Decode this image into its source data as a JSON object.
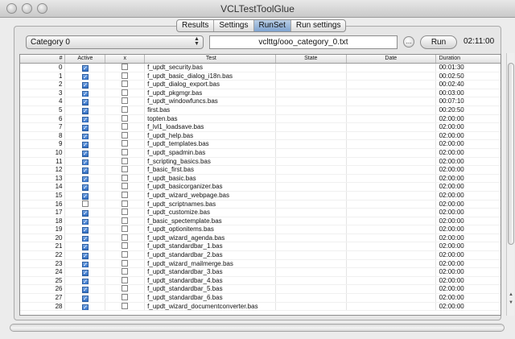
{
  "window": {
    "title": "VCLTestToolGlue"
  },
  "tabs": [
    {
      "label": "Results",
      "active": false
    },
    {
      "label": "Settings",
      "active": false
    },
    {
      "label": "RunSet",
      "active": true
    },
    {
      "label": "Run settings",
      "active": false
    }
  ],
  "toolbar": {
    "category": "Category 0",
    "path": "vclttg/ooo_category_0.txt",
    "browse_label": "...",
    "run_label": "Run",
    "timer": "02:11:00"
  },
  "table": {
    "headers": [
      "#",
      "Active",
      "x",
      "Test",
      "State",
      "Date",
      "Duration"
    ],
    "rows": [
      {
        "num": "0",
        "active": true,
        "x": false,
        "test": "f_updt_security.bas",
        "state": "",
        "date": "",
        "duration": "00:01:30"
      },
      {
        "num": "1",
        "active": true,
        "x": false,
        "test": "f_updt_basic_dialog_i18n.bas",
        "state": "",
        "date": "",
        "duration": "00:02:50"
      },
      {
        "num": "2",
        "active": true,
        "x": false,
        "test": "f_updt_dialog_export.bas",
        "state": "",
        "date": "",
        "duration": "00:02:40"
      },
      {
        "num": "3",
        "active": true,
        "x": false,
        "test": "f_updt_pkgmgr.bas",
        "state": "",
        "date": "",
        "duration": "00:03:00"
      },
      {
        "num": "4",
        "active": true,
        "x": false,
        "test": "f_updt_windowfuncs.bas",
        "state": "",
        "date": "",
        "duration": "00:07:10"
      },
      {
        "num": "5",
        "active": true,
        "x": false,
        "test": "first.bas",
        "state": "",
        "date": "",
        "duration": "00:20:50"
      },
      {
        "num": "6",
        "active": true,
        "x": false,
        "test": "topten.bas",
        "state": "",
        "date": "",
        "duration": "02:00:00"
      },
      {
        "num": "7",
        "active": true,
        "x": false,
        "test": "f_lvl1_loadsave.bas",
        "state": "",
        "date": "",
        "duration": "02:00:00"
      },
      {
        "num": "8",
        "active": true,
        "x": false,
        "test": "f_updt_help.bas",
        "state": "",
        "date": "",
        "duration": "02:00:00"
      },
      {
        "num": "9",
        "active": true,
        "x": false,
        "test": "f_updt_templates.bas",
        "state": "",
        "date": "",
        "duration": "02:00:00"
      },
      {
        "num": "10",
        "active": true,
        "x": false,
        "test": "f_updt_spadmin.bas",
        "state": "",
        "date": "",
        "duration": "02:00:00"
      },
      {
        "num": "11",
        "active": true,
        "x": false,
        "test": "f_scripting_basics.bas",
        "state": "",
        "date": "",
        "duration": "02:00:00"
      },
      {
        "num": "12",
        "active": true,
        "x": false,
        "test": "f_basic_first.bas",
        "state": "",
        "date": "",
        "duration": "02:00:00"
      },
      {
        "num": "13",
        "active": true,
        "x": false,
        "test": "f_updt_basic.bas",
        "state": "",
        "date": "",
        "duration": "02:00:00"
      },
      {
        "num": "14",
        "active": true,
        "x": false,
        "test": "f_updt_basicorganizer.bas",
        "state": "",
        "date": "",
        "duration": "02:00:00"
      },
      {
        "num": "15",
        "active": true,
        "x": false,
        "test": "f_updt_wizard_webpage.bas",
        "state": "",
        "date": "",
        "duration": "02:00:00"
      },
      {
        "num": "16",
        "active": false,
        "x": false,
        "test": "f_updt_scriptnames.bas",
        "state": "",
        "date": "",
        "duration": "02:00:00"
      },
      {
        "num": "17",
        "active": true,
        "x": false,
        "test": "f_updt_customize.bas",
        "state": "",
        "date": "",
        "duration": "02:00:00"
      },
      {
        "num": "18",
        "active": true,
        "x": false,
        "test": "f_basic_spectemplate.bas",
        "state": "",
        "date": "",
        "duration": "02:00:00"
      },
      {
        "num": "19",
        "active": true,
        "x": false,
        "test": "f_updt_optionitems.bas",
        "state": "",
        "date": "",
        "duration": "02:00:00"
      },
      {
        "num": "20",
        "active": true,
        "x": false,
        "test": "f_updt_wizard_agenda.bas",
        "state": "",
        "date": "",
        "duration": "02:00:00"
      },
      {
        "num": "21",
        "active": true,
        "x": false,
        "test": "f_updt_standardbar_1.bas",
        "state": "",
        "date": "",
        "duration": "02:00:00"
      },
      {
        "num": "22",
        "active": true,
        "x": false,
        "test": "f_updt_standardbar_2.bas",
        "state": "",
        "date": "",
        "duration": "02:00:00"
      },
      {
        "num": "23",
        "active": true,
        "x": false,
        "test": "f_updt_wizard_mailmerge.bas",
        "state": "",
        "date": "",
        "duration": "02:00:00"
      },
      {
        "num": "24",
        "active": true,
        "x": false,
        "test": "f_updt_standardbar_3.bas",
        "state": "",
        "date": "",
        "duration": "02:00:00"
      },
      {
        "num": "25",
        "active": true,
        "x": false,
        "test": "f_updt_standardbar_4.bas",
        "state": "",
        "date": "",
        "duration": "02:00:00"
      },
      {
        "num": "26",
        "active": true,
        "x": false,
        "test": "f_updt_standardbar_5.bas",
        "state": "",
        "date": "",
        "duration": "02:00:00"
      },
      {
        "num": "27",
        "active": true,
        "x": false,
        "test": "f_updt_standardbar_6.bas",
        "state": "",
        "date": "",
        "duration": "02:00:00"
      },
      {
        "num": "28",
        "active": true,
        "x": false,
        "test": "f_updt_wizard_documentconverter.bas",
        "state": "",
        "date": "",
        "duration": "02:00:00"
      }
    ]
  },
  "colors": {
    "selected_tab": "#8aaad6",
    "checkbox_checked": "#2e6cc2",
    "window_bg": "#ececec"
  },
  "progress": {
    "value": 0
  }
}
